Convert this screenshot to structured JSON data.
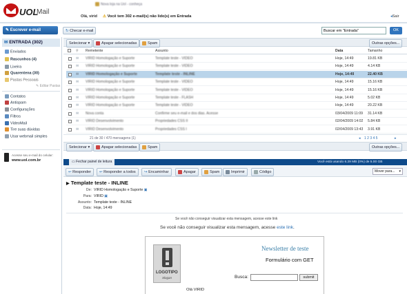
{
  "logo": {
    "brand": "UOL",
    "product": "Mail"
  },
  "header": {
    "greeting": "Olá, virid",
    "alert": "Você tem 302 e-mail(s) não lido(s) em Entrada",
    "exit": "Sair",
    "promo": "Nova loja na Uol - conheça"
  },
  "toolbar": {
    "compose": "Escrever e-mail",
    "check": "Checar e-mail",
    "search_value": "Buscar em \"Entrada\"",
    "search_go": "OK"
  },
  "sidebar": {
    "inbox": "ENTRADA (302)",
    "folders": [
      {
        "label": "Enviados",
        "icon": "sent-icon"
      },
      {
        "label": "Rascunhos (4)",
        "icon": "drafts-icon"
      },
      {
        "label": "Lixeira",
        "icon": "trash-icon"
      },
      {
        "label": "Quarentena (30)",
        "icon": "quarantine-icon"
      },
      {
        "label": "Pastas Pessoais",
        "icon": "folder-icon"
      }
    ],
    "edit_folders": "Editar Pastas",
    "tools": [
      {
        "label": "Contatos",
        "icon": "contacts-icon"
      },
      {
        "label": "Antispam",
        "icon": "antispam-icon"
      },
      {
        "label": "Configurações",
        "icon": "settings-icon"
      },
      {
        "label": "Filtros",
        "icon": "filters-icon"
      },
      {
        "label": "VideoMail",
        "icon": "videomail-icon"
      },
      {
        "label": "Tire suas dúvidas",
        "icon": "help-icon"
      },
      {
        "label": "Usar webmail simples",
        "icon": "simple-webmail-icon"
      }
    ],
    "mobile_line1": "Acesse seu e-mail do celular:",
    "mobile_line2": "www.uol.com.br"
  },
  "list": {
    "select": "Selecionar",
    "delete": "Apagar selecionadas",
    "spam": "Spam",
    "more": "Outras opções...",
    "columns": {
      "sender": "Remetente",
      "subject": "Assunto",
      "date": "Data",
      "size": "Tamanho"
    },
    "rows": [
      {
        "sender": "VIRID Homologação e Suporte",
        "subject": "Template teste - VIDEO",
        "date": "Hoje, 14:49",
        "size": "19.81 KB",
        "selected": false
      },
      {
        "sender": "VIRID Homologação e Suporte",
        "subject": "Template teste - VIDEO",
        "date": "Hoje, 14:49",
        "size": "4.14 KB",
        "selected": false
      },
      {
        "sender": "VIRID Homologação e Suporte",
        "subject": "Template teste - INLINE",
        "date": "Hoje, 14:49",
        "size": "22.40 KB",
        "selected": true
      },
      {
        "sender": "VIRID Homologação e Suporte",
        "subject": "Template teste - VIDEO",
        "date": "Hoje, 14:49",
        "size": "15.16 KB",
        "selected": false
      },
      {
        "sender": "VIRID Homologação e Suporte",
        "subject": "Template teste - VIDEO",
        "date": "Hoje, 14:49",
        "size": "15.16 KB",
        "selected": false
      },
      {
        "sender": "VIRID Homologação e Suporte",
        "subject": "Template teste - FLASH",
        "date": "Hoje, 14:49",
        "size": "5.02 KB",
        "selected": false
      },
      {
        "sender": "VIRID Homologação e Suporte",
        "subject": "Template teste - VIDEO",
        "date": "Hoje, 14:49",
        "size": "20.22 KB",
        "selected": false
      },
      {
        "sender": "Nova conta",
        "subject": "Confirme seu e-mail e dos dias. Acesse",
        "date": "03/04/2009 11:09",
        "size": "31.14 KB",
        "selected": false
      },
      {
        "sender": "VIRID Desenvolvimento",
        "subject": "Propriedades CSS II",
        "date": "02/04/2009 14:02",
        "size": "5.84 KB",
        "selected": false
      },
      {
        "sender": "VIRID Desenvolvimento",
        "subject": "Propriedades CSS I",
        "date": "02/04/2009 13:43",
        "size": "3.91 KB",
        "selected": false
      }
    ],
    "pagination": "21 de 30 / 470 mensagens (1)",
    "pages": "1 2 3 4 5"
  },
  "panel": {
    "close": "Fechar painel de leitura",
    "usage": "Você está usando 6.29 MB (0%) de 5.00 GB"
  },
  "actions": {
    "reply": "Responder",
    "reply_all": "Responder a todos",
    "forward": "Encaminhar",
    "delete": "Apagar",
    "spam": "Spam",
    "print": "Imprimir",
    "code": "Código",
    "move": "Mover para..."
  },
  "message": {
    "subject": "Template teste - INLINE",
    "from_label": "De:",
    "from": "VIRID Homologação e Suporte",
    "to_label": "Para:",
    "to": "VIRID",
    "subject_label": "Assunto:",
    "subject_value": "Template teste - INLINE",
    "date_label": "Data:",
    "date": "Hoje, 14:49",
    "notice_small": "Se você não conseguir visualizar esta mensagem, acesse este link",
    "notice_pre": "Se você não conseguir visualizar esta mensagem, acesse ",
    "notice_link": "este link",
    "notice_post": ".",
    "newsletter_title": "Newsletter de teste",
    "form_title": "Formulário com GET",
    "logo_text": "LOGOTIPO",
    "logo_slogan": "Slogan",
    "search_label": "Busca:",
    "submit": "submit",
    "greeting": "Olá VIRID"
  }
}
